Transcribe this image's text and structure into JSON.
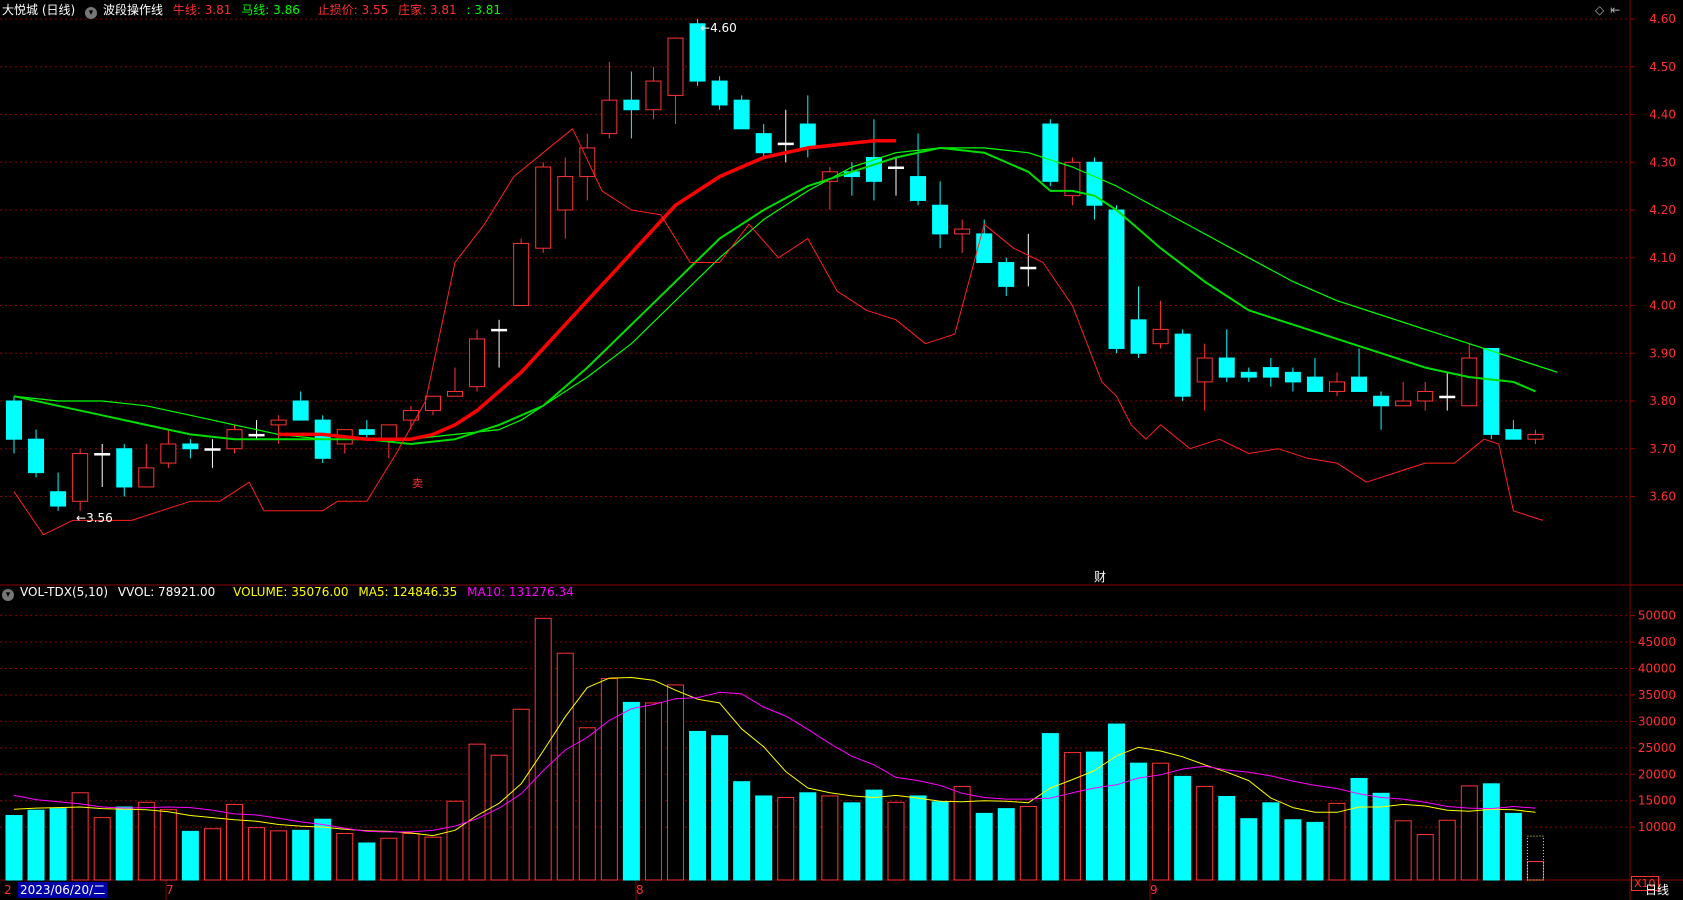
{
  "top_header": {
    "stock": "大悦城 (日线)",
    "indicator": "波段操作线",
    "cow_label": "牛线: 3.81",
    "horse_label": "马线: 3.86",
    "stop_label": "止损价: 3.55",
    "dealer_label": "庄家: 3.81",
    "extra_label": ": 3.81",
    "icons": [
      "diamond-icon",
      "left-bar-icon"
    ]
  },
  "vol_header": {
    "name": "VOL-TDX(5,10)",
    "vvol": "VVOL: 78921.00",
    "volume": "VOLUME: 35076.00",
    "ma5": "MA5: 124846.35",
    "ma10": "MA10: 131276.34"
  },
  "annotations": {
    "high": "4.60",
    "low": "3.56",
    "cai": "财",
    "sell": "卖"
  },
  "x_axis": {
    "date_tag": "2023/06/20/二",
    "months": [
      "7",
      "8",
      "9"
    ],
    "first": "2"
  },
  "bottom_right": {
    "period": "日线",
    "scale": "X10"
  },
  "colors": {
    "up": "#ff3333",
    "down": "#00ffff",
    "cow": "#ff0000",
    "horse": "#00ff00",
    "horse2": "#00dd00",
    "stop": "#ff2020",
    "ma5": "#ffff00",
    "ma10": "#ff00ff",
    "grid": "#8b0000"
  },
  "chart_data": [
    {
      "type": "candlestick",
      "y_ticks": [
        "4.60",
        "4.50",
        "4.40",
        "4.30",
        "4.20",
        "4.10",
        "4.00",
        "3.90",
        "3.80",
        "3.70",
        "3.60"
      ],
      "ylim": [
        3.475,
        4.61
      ],
      "ohlc": [
        [
          3.8,
          3.81,
          3.69,
          3.72
        ],
        [
          3.72,
          3.74,
          3.64,
          3.65
        ],
        [
          3.61,
          3.65,
          3.57,
          3.58
        ],
        [
          3.59,
          3.7,
          3.57,
          3.69
        ],
        [
          3.69,
          3.71,
          3.62,
          3.69
        ],
        [
          3.7,
          3.71,
          3.6,
          3.62
        ],
        [
          3.62,
          3.71,
          3.62,
          3.66
        ],
        [
          3.67,
          3.74,
          3.66,
          3.71
        ],
        [
          3.71,
          3.72,
          3.68,
          3.7
        ],
        [
          3.7,
          3.72,
          3.66,
          3.7
        ],
        [
          3.7,
          3.75,
          3.69,
          3.74
        ],
        [
          3.73,
          3.76,
          3.72,
          3.73
        ],
        [
          3.75,
          3.77,
          3.71,
          3.76
        ],
        [
          3.8,
          3.82,
          3.76,
          3.76
        ],
        [
          3.76,
          3.77,
          3.67,
          3.68
        ],
        [
          3.71,
          3.74,
          3.69,
          3.74
        ],
        [
          3.74,
          3.76,
          3.72,
          3.73
        ],
        [
          3.72,
          3.75,
          3.68,
          3.75
        ],
        [
          3.76,
          3.79,
          3.74,
          3.78
        ],
        [
          3.78,
          3.81,
          3.77,
          3.81
        ],
        [
          3.81,
          3.87,
          3.81,
          3.82
        ],
        [
          3.83,
          3.95,
          3.82,
          3.93
        ],
        [
          3.95,
          3.97,
          3.87,
          3.95
        ],
        [
          4.0,
          4.14,
          4.0,
          4.13
        ],
        [
          4.12,
          4.3,
          4.11,
          4.29
        ],
        [
          4.2,
          4.31,
          4.14,
          4.27
        ],
        [
          4.27,
          4.36,
          4.22,
          4.33
        ],
        [
          4.36,
          4.51,
          4.35,
          4.43
        ],
        [
          4.43,
          4.49,
          4.35,
          4.41
        ],
        [
          4.41,
          4.5,
          4.39,
          4.47
        ],
        [
          4.44,
          4.56,
          4.38,
          4.56
        ],
        [
          4.59,
          4.6,
          4.46,
          4.47
        ],
        [
          4.47,
          4.48,
          4.41,
          4.42
        ],
        [
          4.43,
          4.44,
          4.37,
          4.37
        ],
        [
          4.36,
          4.38,
          4.31,
          4.32
        ],
        [
          4.34,
          4.41,
          4.3,
          4.34
        ],
        [
          4.38,
          4.44,
          4.31,
          4.33
        ],
        [
          4.26,
          4.29,
          4.2,
          4.28
        ],
        [
          4.28,
          4.3,
          4.23,
          4.27
        ],
        [
          4.31,
          4.39,
          4.22,
          4.26
        ],
        [
          4.29,
          4.31,
          4.23,
          4.29
        ],
        [
          4.27,
          4.36,
          4.21,
          4.22
        ],
        [
          4.21,
          4.26,
          4.12,
          4.15
        ],
        [
          4.15,
          4.18,
          4.11,
          4.16
        ],
        [
          4.15,
          4.18,
          4.09,
          4.09
        ],
        [
          4.09,
          4.1,
          4.02,
          4.04
        ],
        [
          4.08,
          4.15,
          4.04,
          4.08
        ],
        [
          4.38,
          4.39,
          4.25,
          4.26
        ],
        [
          4.23,
          4.31,
          4.21,
          4.3
        ],
        [
          4.3,
          4.31,
          4.18,
          4.21
        ],
        [
          4.2,
          4.21,
          3.9,
          3.91
        ],
        [
          3.97,
          4.04,
          3.89,
          3.9
        ],
        [
          3.92,
          4.01,
          3.91,
          3.95
        ],
        [
          3.94,
          3.95,
          3.8,
          3.81
        ],
        [
          3.84,
          3.92,
          3.78,
          3.89
        ],
        [
          3.89,
          3.95,
          3.84,
          3.85
        ],
        [
          3.86,
          3.87,
          3.84,
          3.85
        ],
        [
          3.87,
          3.89,
          3.83,
          3.85
        ],
        [
          3.86,
          3.87,
          3.82,
          3.84
        ],
        [
          3.85,
          3.89,
          3.82,
          3.82
        ],
        [
          3.82,
          3.86,
          3.81,
          3.84
        ],
        [
          3.85,
          3.91,
          3.82,
          3.82
        ],
        [
          3.81,
          3.82,
          3.74,
          3.79
        ],
        [
          3.79,
          3.84,
          3.79,
          3.8
        ],
        [
          3.8,
          3.84,
          3.78,
          3.82
        ],
        [
          3.81,
          3.86,
          3.78,
          3.81
        ],
        [
          3.79,
          3.92,
          3.79,
          3.89
        ],
        [
          3.91,
          3.91,
          3.72,
          3.73
        ],
        [
          3.74,
          3.76,
          3.72,
          3.72
        ],
        [
          3.72,
          3.74,
          3.71,
          3.73
        ]
      ],
      "cow_line": [
        [
          12,
          3.73
        ],
        [
          14,
          3.73
        ],
        [
          16,
          3.72
        ],
        [
          18,
          3.72
        ],
        [
          19,
          3.73
        ],
        [
          20,
          3.75
        ],
        [
          21,
          3.78
        ],
        [
          22,
          3.82
        ],
        [
          23,
          3.86
        ],
        [
          24,
          3.91
        ],
        [
          25,
          3.96
        ],
        [
          26,
          4.01
        ],
        [
          27,
          4.06
        ],
        [
          28,
          4.11
        ],
        [
          29,
          4.16
        ],
        [
          30,
          4.21
        ],
        [
          31,
          4.24
        ],
        [
          32,
          4.27
        ],
        [
          33,
          4.29
        ],
        [
          34,
          4.31
        ],
        [
          35,
          4.32
        ],
        [
          36,
          4.33
        ],
        [
          37,
          4.335
        ],
        [
          38,
          4.34
        ],
        [
          39,
          4.345
        ],
        [
          40,
          4.345
        ]
      ],
      "horse_line": [
        [
          0,
          3.81
        ],
        [
          2,
          3.8
        ],
        [
          4,
          3.8
        ],
        [
          6,
          3.79
        ],
        [
          8,
          3.77
        ],
        [
          10,
          3.75
        ],
        [
          12,
          3.73
        ],
        [
          14,
          3.72
        ],
        [
          16,
          3.72
        ],
        [
          18,
          3.72
        ],
        [
          20,
          3.73
        ],
        [
          22,
          3.74
        ],
        [
          23,
          3.76
        ],
        [
          24,
          3.79
        ],
        [
          26,
          3.85
        ],
        [
          28,
          3.92
        ],
        [
          30,
          4.01
        ],
        [
          32,
          4.1
        ],
        [
          34,
          4.18
        ],
        [
          36,
          4.24
        ],
        [
          38,
          4.29
        ],
        [
          40,
          4.32
        ],
        [
          42,
          4.33
        ],
        [
          44,
          4.33
        ],
        [
          46,
          4.32
        ],
        [
          48,
          4.29
        ],
        [
          50,
          4.25
        ],
        [
          52,
          4.2
        ],
        [
          54,
          4.15
        ],
        [
          56,
          4.1
        ],
        [
          58,
          4.05
        ],
        [
          60,
          4.01
        ],
        [
          62,
          3.98
        ],
        [
          64,
          3.95
        ],
        [
          66,
          3.92
        ],
        [
          68,
          3.89
        ],
        [
          70,
          3.86
        ]
      ],
      "dealer_line": [
        [
          0,
          3.81
        ],
        [
          2,
          3.79
        ],
        [
          4,
          3.77
        ],
        [
          6,
          3.75
        ],
        [
          8,
          3.73
        ],
        [
          10,
          3.72
        ],
        [
          12,
          3.72
        ],
        [
          14,
          3.72
        ],
        [
          16,
          3.72
        ],
        [
          18,
          3.71
        ],
        [
          20,
          3.72
        ],
        [
          22,
          3.75
        ],
        [
          24,
          3.79
        ],
        [
          26,
          3.87
        ],
        [
          28,
          3.96
        ],
        [
          30,
          4.05
        ],
        [
          32,
          4.14
        ],
        [
          34,
          4.2
        ],
        [
          36,
          4.25
        ],
        [
          38,
          4.28
        ],
        [
          40,
          4.31
        ],
        [
          42,
          4.33
        ],
        [
          44,
          4.32
        ],
        [
          46,
          4.28
        ],
        [
          47,
          4.24
        ],
        [
          48,
          4.24
        ],
        [
          49,
          4.23
        ],
        [
          50,
          4.2
        ],
        [
          52,
          4.12
        ],
        [
          54,
          4.05
        ],
        [
          56,
          3.99
        ],
        [
          58,
          3.96
        ],
        [
          60,
          3.93
        ],
        [
          62,
          3.9
        ],
        [
          64,
          3.87
        ],
        [
          66,
          3.85
        ],
        [
          68,
          3.84
        ],
        [
          69,
          3.82
        ]
      ],
      "stop_line": [
        [
          0,
          3.61
        ],
        [
          2,
          3.52
        ],
        [
          4,
          3.55
        ],
        [
          8,
          3.55
        ],
        [
          10,
          3.57
        ],
        [
          12,
          3.59
        ],
        [
          14,
          3.59
        ],
        [
          16,
          3.63
        ],
        [
          17,
          3.57
        ],
        [
          19,
          3.57
        ],
        [
          21,
          3.57
        ],
        [
          22,
          3.59
        ],
        [
          23,
          3.59
        ],
        [
          24,
          3.59
        ],
        [
          26,
          3.69
        ],
        [
          28,
          3.8
        ],
        [
          30,
          4.09
        ],
        [
          32,
          4.17
        ],
        [
          34,
          4.27
        ],
        [
          36,
          4.32
        ],
        [
          38,
          4.37
        ],
        [
          40,
          4.24
        ],
        [
          42,
          4.2
        ],
        [
          44,
          4.19
        ],
        [
          46,
          4.09
        ],
        [
          48,
          4.09
        ],
        [
          50,
          4.17
        ],
        [
          52,
          4.1
        ],
        [
          54,
          4.14
        ],
        [
          56,
          4.03
        ],
        [
          58,
          3.99
        ],
        [
          60,
          3.97
        ],
        [
          62,
          3.92
        ],
        [
          64,
          3.94
        ],
        [
          66,
          4.17
        ],
        [
          68,
          4.12
        ],
        [
          70,
          4.09
        ],
        [
          72,
          4.0
        ],
        [
          74,
          3.84
        ],
        [
          75,
          3.81
        ],
        [
          76,
          3.75
        ],
        [
          77,
          3.72
        ],
        [
          78,
          3.75
        ],
        [
          80,
          3.7
        ],
        [
          82,
          3.72
        ],
        [
          84,
          3.69
        ],
        [
          86,
          3.7
        ],
        [
          88,
          3.68
        ],
        [
          90,
          3.67
        ],
        [
          92,
          3.63
        ],
        [
          94,
          3.65
        ],
        [
          96,
          3.67
        ],
        [
          98,
          3.67
        ],
        [
          100,
          3.72
        ],
        [
          101,
          3.71
        ],
        [
          102,
          3.57
        ],
        [
          103,
          3.56
        ],
        [
          104,
          3.55
        ]
      ],
      "stop_points_per_candle": 1.5
    },
    {
      "type": "bar",
      "y_ticks": [
        "50000",
        "45000",
        "40000",
        "35000",
        "30000",
        "25000",
        "20000",
        "15000",
        "10000"
      ],
      "ylim": [
        0,
        52400
      ],
      "volumes": [
        12200,
        13200,
        13500,
        16500,
        11800,
        13800,
        14700,
        13300,
        9200,
        9700,
        14300,
        9900,
        9300,
        9400,
        11500,
        8800,
        7000,
        7900,
        8800,
        8100,
        14900,
        25700,
        23600,
        32300,
        49500,
        42900,
        28800,
        38100,
        33600,
        33500,
        36900,
        28100,
        27300,
        18600,
        15900,
        15600,
        16500,
        15900,
        14600,
        17000,
        14700,
        15900,
        14800,
        17700,
        12600,
        13500,
        13900,
        27700,
        24100,
        24200,
        29500,
        22100,
        22100,
        19600,
        17700,
        15800,
        11600,
        14600,
        11400,
        10900,
        14500,
        19200,
        16400,
        11200,
        8600,
        11300,
        17800,
        18200,
        12600,
        3500
      ],
      "ma5": [
        13400,
        13600,
        13700,
        13800,
        13500,
        13400,
        13300,
        12900,
        12200,
        11800,
        11400,
        11100,
        10500,
        10200,
        10000,
        9600,
        9300,
        9200,
        8900,
        8400,
        9400,
        12200,
        14500,
        18200,
        24400,
        30900,
        36400,
        38200,
        38300,
        37800,
        35900,
        34200,
        33500,
        28600,
        25200,
        20500,
        17400,
        16500,
        15900,
        15600,
        16000,
        15500,
        14900,
        14800,
        15000,
        14900,
        14600,
        17400,
        19000,
        20700,
        23500,
        25100,
        24400,
        23300,
        21800,
        20400,
        18800,
        15500,
        13700,
        12800,
        12800,
        13800,
        13800,
        14300,
        14000,
        13200,
        13000,
        13400,
        13300,
        12800
      ],
      "ma10": [
        16000,
        15200,
        14800,
        14400,
        13800,
        13600,
        13700,
        13800,
        13700,
        13200,
        12500,
        12300,
        11700,
        11000,
        10500,
        9800,
        9200,
        9100,
        9100,
        9400,
        10200,
        11600,
        13600,
        16300,
        20700,
        24600,
        27000,
        30200,
        32400,
        33200,
        34300,
        34500,
        35500,
        35200,
        32700,
        31000,
        28500,
        25800,
        23400,
        21800,
        19400,
        18800,
        17900,
        16400,
        15600,
        15300,
        15300,
        15500,
        16500,
        17400,
        18000,
        19300,
        19900,
        21000,
        21500,
        20800,
        20400,
        19700,
        18700,
        17900,
        17300,
        16300,
        15600,
        15300,
        14700,
        13900,
        13600,
        13500,
        13900,
        13600
      ]
    }
  ]
}
